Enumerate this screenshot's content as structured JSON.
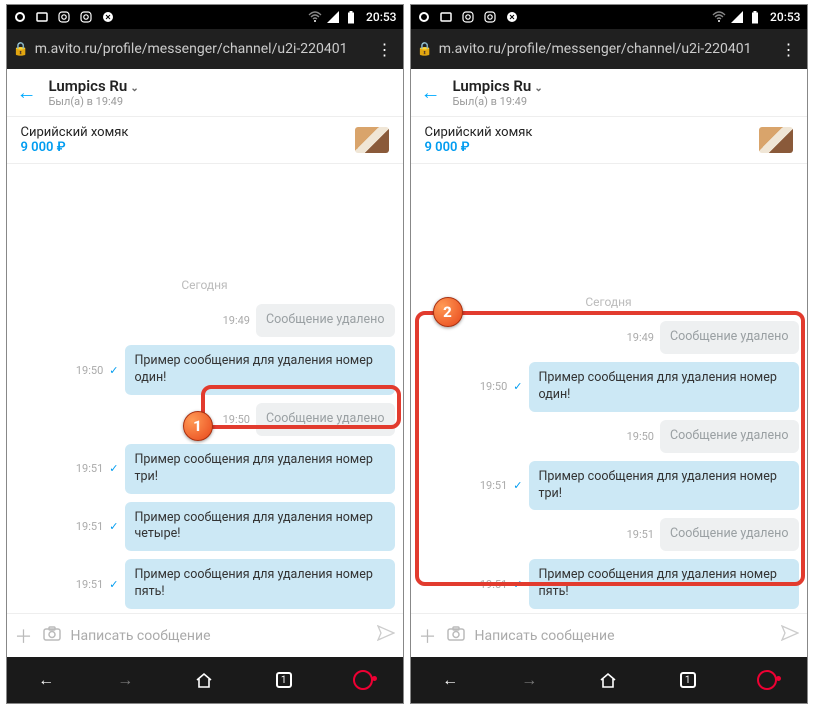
{
  "status": {
    "time": "20:53"
  },
  "addr": {
    "url": "m.avito.ru/profile/messenger/channel/u2i-220401"
  },
  "header": {
    "name": "Lumpics Ru",
    "last_seen": "Был(а) в 19:49"
  },
  "listing": {
    "title": "Сирийский хомяк",
    "price": "9 000 ₽"
  },
  "chat": {
    "date_separator": "Сегодня",
    "deleted_text": "Сообщение удалено"
  },
  "left_panel": {
    "messages": [
      {
        "time": "19:49",
        "deleted": true
      },
      {
        "time": "19:50",
        "text": "Пример сообщения для удаления номер один!"
      },
      {
        "time": "19:50",
        "deleted": true
      },
      {
        "time": "19:51",
        "text": "Пример сообщения для удаления номер три!"
      },
      {
        "time": "19:51",
        "text": "Пример сообщения для удаления номер четыре!"
      },
      {
        "time": "19:51",
        "text": "Пример сообщения для удаления номер пять!"
      }
    ]
  },
  "right_panel": {
    "messages": [
      {
        "time": "19:49",
        "deleted": true
      },
      {
        "time": "19:50",
        "text": "Пример сообщения для удаления номер один!"
      },
      {
        "time": "19:50",
        "deleted": true
      },
      {
        "time": "19:51",
        "text": "Пример сообщения для удаления номер три!"
      },
      {
        "time": "19:51",
        "deleted": true
      },
      {
        "time": "19:51",
        "text": "Пример сообщения для удаления номер пять!"
      }
    ]
  },
  "input": {
    "placeholder": "Написать сообщение"
  },
  "nav": {
    "tabs_count": "1"
  },
  "badges": {
    "one": "1",
    "two": "2"
  }
}
